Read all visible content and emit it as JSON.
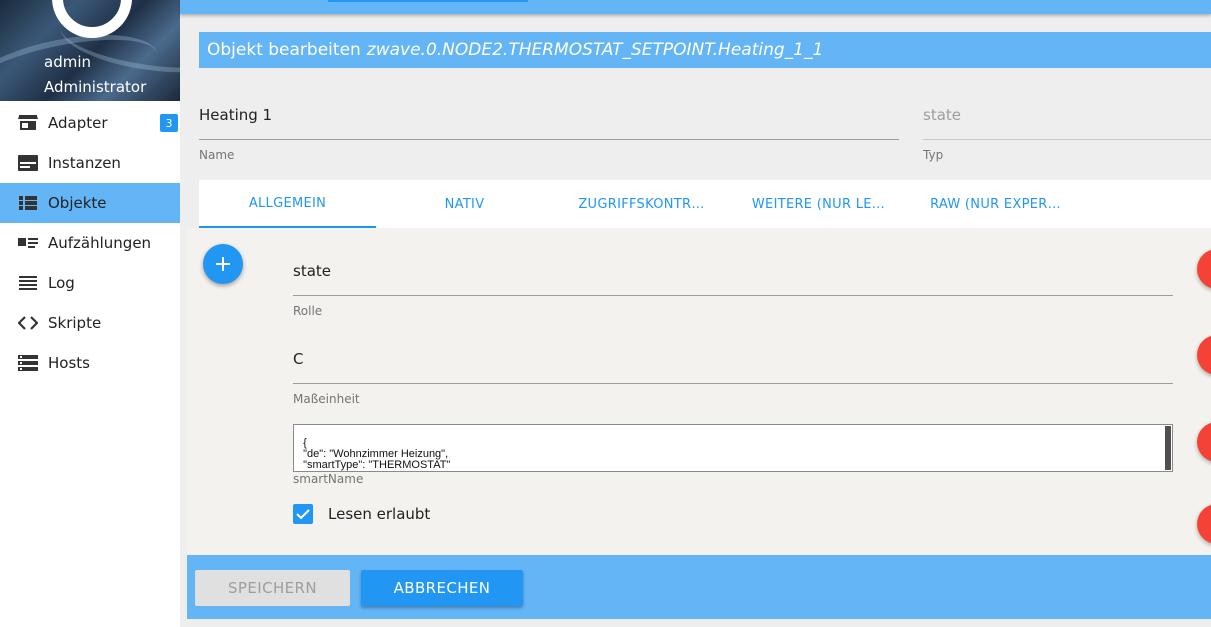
{
  "user": {
    "name": "admin",
    "role": "Administrator"
  },
  "nav": {
    "items": [
      {
        "label": "Adapter",
        "icon": "store-icon",
        "badge": "3"
      },
      {
        "label": "Instanzen",
        "icon": "instances-icon"
      },
      {
        "label": "Objekte",
        "icon": "list-icon",
        "active": true
      },
      {
        "label": "Aufzählungen",
        "icon": "enum-icon"
      },
      {
        "label": "Log",
        "icon": "log-icon"
      },
      {
        "label": "Skripte",
        "icon": "code-icon"
      },
      {
        "label": "Hosts",
        "icon": "hosts-icon"
      }
    ]
  },
  "dialog": {
    "title_prefix": "Objekt bearbeiten",
    "object_id": "zwave.0.NODE2.THERMOSTAT_SETPOINT.Heating_1_1"
  },
  "fields": {
    "name": {
      "value": "Heating 1",
      "label": "Name"
    },
    "type": {
      "value": "state",
      "label": "Typ"
    },
    "role": {
      "value": "state",
      "label": "Rolle"
    },
    "unit": {
      "value": "C",
      "label": "Maßeinheit"
    },
    "smartname": {
      "value": "{\n  \"de\": \"Wohnzimmer Heizung\",\n  \"smartType\": \"THERMOSTAT\"\n}",
      "label": "smartName"
    },
    "read": {
      "label": "Lesen erlaubt",
      "checked": true
    }
  },
  "tabs": [
    "ALLGEMEIN",
    "NATIV",
    "ZUGRIFFSKONTR…",
    "WEITERE (NUR LE…",
    "RAW (NUR EXPER…"
  ],
  "buttons": {
    "save": "SPEICHERN",
    "cancel": "ABBRECHEN"
  },
  "colors": {
    "primary": "#2196f3",
    "header": "#64b5f6",
    "delete": "#f44336"
  }
}
